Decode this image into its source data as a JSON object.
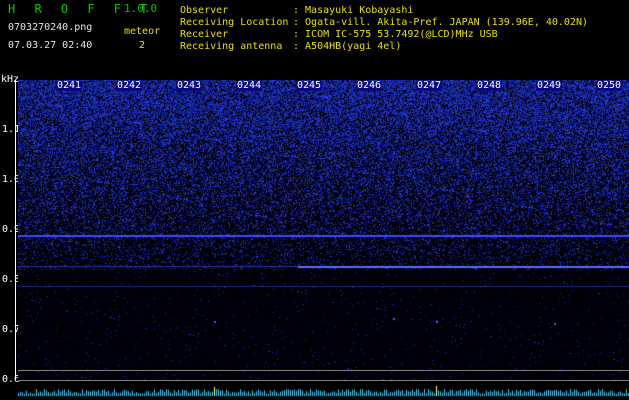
{
  "app": {
    "name": "H R O F F T",
    "version": "1.0.0"
  },
  "file": {
    "name": "0703270240.png",
    "datetime": "07.03.27 02:40"
  },
  "meteor": {
    "label": "meteor",
    "count": "2"
  },
  "info": [
    {
      "key": "Observer",
      "value": ": Masayuki Kobayashi"
    },
    {
      "key": "Receiving Location",
      "value": ": Ogata-vill. Akita-Pref. JAPAN (139.96E, 40.02N)"
    },
    {
      "key": "Receiver",
      "value": ": ICOM IC-575 53.7492(@LCD)MHz USB"
    },
    {
      "key": "Receiving antenna",
      "value": ": A504HB(yagi 4el)"
    }
  ],
  "axis": {
    "unit": "kHz",
    "labels": [
      "1.1",
      "1.0",
      "0.9",
      "0.8",
      "0.7",
      "0.6"
    ]
  },
  "time_markers": [
    "0241",
    "0242",
    "0243",
    "0244",
    "0245",
    "0246",
    "0247",
    "0248",
    "0249",
    "0250"
  ],
  "colors": {
    "title": "#00c800",
    "info": "#e8e000",
    "spectrum": "#2a3cff",
    "signal_line": "#5a6cff",
    "trace": "#3ad2ff"
  }
}
